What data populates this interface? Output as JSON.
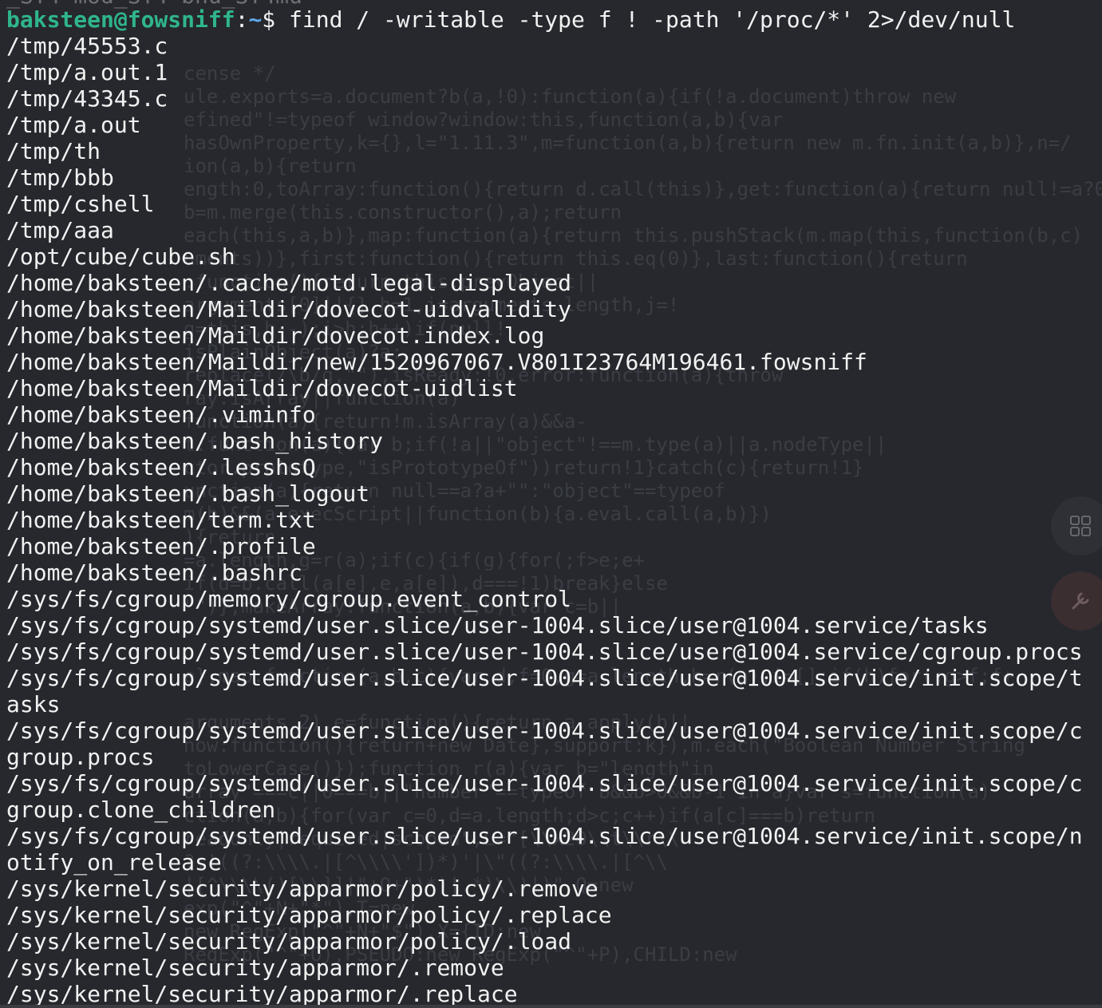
{
  "terminal": {
    "prompt": {
      "user_host": "baksteen@fowsniff",
      "colon": ":",
      "path": "~",
      "symbol": "$"
    },
    "command": " find / -writable -type f ! -path '/proc/*' 2>/dev/null",
    "output": [
      "/tmp/45553.c",
      "/tmp/a.out.1",
      "/tmp/43345.c",
      "/tmp/a.out",
      "/tmp/th",
      "/tmp/bbb",
      "/tmp/cshell",
      "/tmp/aaa",
      "/opt/cube/cube.sh",
      "/home/baksteen/.cache/motd.legal-displayed",
      "/home/baksteen/Maildir/dovecot-uidvalidity",
      "/home/baksteen/Maildir/dovecot.index.log",
      "/home/baksteen/Maildir/new/1520967067.V801I23764M196461.fowsniff",
      "/home/baksteen/Maildir/dovecot-uidlist",
      "/home/baksteen/.viminfo",
      "/home/baksteen/.bash_history",
      "/home/baksteen/.lesshsQ",
      "/home/baksteen/.bash_logout",
      "/home/baksteen/term.txt",
      "/home/baksteen/.profile",
      "/home/baksteen/.bashrc",
      "/sys/fs/cgroup/memory/cgroup.event_control",
      "/sys/fs/cgroup/systemd/user.slice/user-1004.slice/user@1004.service/tasks",
      "/sys/fs/cgroup/systemd/user.slice/user-1004.slice/user@1004.service/cgroup.procs",
      "/sys/fs/cgroup/systemd/user.slice/user-1004.slice/user@1004.service/init.scope/t",
      "asks",
      "/sys/fs/cgroup/systemd/user.slice/user-1004.slice/user@1004.service/init.scope/c",
      "group.procs",
      "/sys/fs/cgroup/systemd/user.slice/user-1004.slice/user@1004.service/init.scope/c",
      "group.clone_children",
      "/sys/fs/cgroup/systemd/user.slice/user-1004.slice/user@1004.service/init.scope/n",
      "otify_on_release",
      "/sys/kernel/security/apparmor/policy/.remove",
      "/sys/kernel/security/apparmor/policy/.replace",
      "/sys/kernel/security/apparmor/policy/.load",
      "/sys/kernel/security/apparmor/.remove",
      "/sys/kernel/security/apparmor/.replace"
    ]
  },
  "background_overlay": [
    "cense */",
    "ule.exports=a.document?b(a,!0):function(a){if(!a.document)throw new",
    "efined\"!=typeof window?window:this,function(a,b){var",
    "hasOwnProperty,k={},l=\"1.11.3\",m=function(a,b){return new m.fn.init(a,b)},n=/",
    "ion(a,b){return",
    "ength:0,toArray:function(){return d.call(this)},get:function(a){return null!=a?0>a?",
    "b=m.merge(this.constructor(),a);return",
    "each(this,a,b)},map:function(a){return this.pushStack(m.map(this,function(b,c)",
    "uments))},first:function(){return this.eq(0)},last:function(){return",
    ":function(){return this.prevObject||",
    "arguments[0]||{},h=1,i=arguments.length,j=!",
    "g=this,h--);i>h;h++)if(null!",
    "isPlainObject(a)?a:",
    "replace(/\\b/g,\"\"),isReady:!0,error:function(a){throw",
    "ray.isArray||function(a)",
    "function(a){return!m.isArray(a)&&a-",
    "t:function(a){var b;if(!a||\"object\"!==m.type(a)||a.nodeType||",
    "ctor.prototype,\"isPrototypeOf\"))return!1}catch(c){return!1}",
    "unction(a){return null==a?a+\"\":\"object\"==typeof",
    "m(b)&&(a.execScript||function(b){a.eval.call(a,b)})",
    "){return",
    "=a.length,g=r(a);if(c){if(g){for(;f>e;e+",
    "if(d=b.call(a[e],e,a[e]),d===!1)break}else",
    "\"\")},makeArray:function(a,b){var c=b||",
    "",
    "",
    "e},map:function(a,b,c){var d,f=0,g=a.length,h=r(a),i=[];if(h)for(;g>f;f+",
    "",
    "arguments,2),e=function(){return a.apply(b||",
    "now:function(){return+new Date},support:k}),m.each(\"Boolean Number String",
    "toLowerCase()});function r(a){var b=\"length\"in",
    "array\"===c||0===b||\"number\"==typeof b&&b>0&&b-1 in a}var s=function(a)",
    "ction(a,b){for(var c=0,d=a.length;d>c;c++)if(a[c]===b)return",
    "readonly|required|scoped\",L=\"[\\\\x20\\\\t\\\\r\\\\",
    "?:'((?:\\\\\\\\.|[^\\\\\\\\'])*)'|\\\"((?:\\\\\\\\.|[^\\\\",
    "|[^\\\\\\\\()[\\\\]]|\"+O+\")*)|.*)\\\\)|)\",Q=new",
    "exp(\"^\"+N+\"*\"),T=new",
    "new RegExp(\"^\"+N+\"$\"),X={ID:new",
    "RegExp(\"^\"+O),PSEUDO:new RegExp(\"^\"+P),CHILD:new"
  ],
  "top_partial_line": "_ST4 mod_ST4 bnu_ST4mu"
}
